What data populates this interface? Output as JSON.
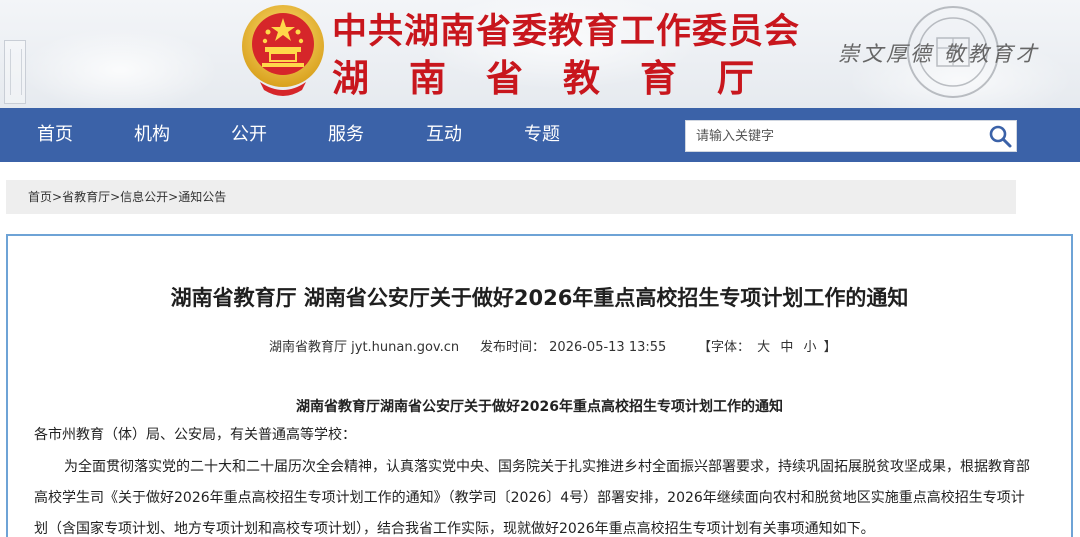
{
  "header": {
    "org_line1": "中共湖南省委教育工作委员会",
    "org_line2": "湖南省教育厅",
    "motto": "崇文厚德 敬教育才",
    "colors": {
      "brand_red": "#c8161d",
      "nav_blue": "#3b62a8",
      "panel_border": "#6ea3d6"
    }
  },
  "nav": {
    "items": [
      {
        "label": "首页"
      },
      {
        "label": "机构"
      },
      {
        "label": "公开"
      },
      {
        "label": "服务"
      },
      {
        "label": "互动"
      },
      {
        "label": "专题"
      }
    ],
    "search": {
      "placeholder": "请输入关键字",
      "icon": "search-icon"
    }
  },
  "breadcrumb": {
    "items": [
      "首页",
      "省教育厅",
      "信息公开",
      "通知公告"
    ],
    "separator": ">"
  },
  "article": {
    "title": "湖南省教育厅 湖南省公安厅关于做好2026年重点高校招生专项计划工作的通知",
    "source": "湖南省教育厅 jyt.hunan.gov.cn",
    "publish_label": "发布时间：",
    "publish_time": "2026-05-13 13:55",
    "font_size_open": "【字体：",
    "font_size_large": "大",
    "font_size_medium": "中",
    "font_size_small": "小",
    "font_size_close": "】",
    "doc_heading": "湖南省教育厅湖南省公安厅关于做好2026年重点高校招生专项计划工作的通知",
    "salutation": "各市州教育（体）局、公安局，有关普通高等学校：",
    "body_lines": [
      "为全面贯彻落实党的二十大和二十届历次全会精神，认真落实党中央、国务院关于扎实推进乡村全面振兴部署要求，持续巩固拓展脱贫攻坚成果，根据教育部",
      "高校学生司《关于做好2026年重点高校招生专项计划工作的通知》（教学司〔2026〕4号）部署安排，2026年继续面向农村和脱贫地区实施重点高校招生专项计",
      "划（含国家专项计划、地方专项计划和高校专项计划），结合我省工作实际，现就做好2026年重点高校招生专项计划有关事项通知如下。"
    ]
  }
}
